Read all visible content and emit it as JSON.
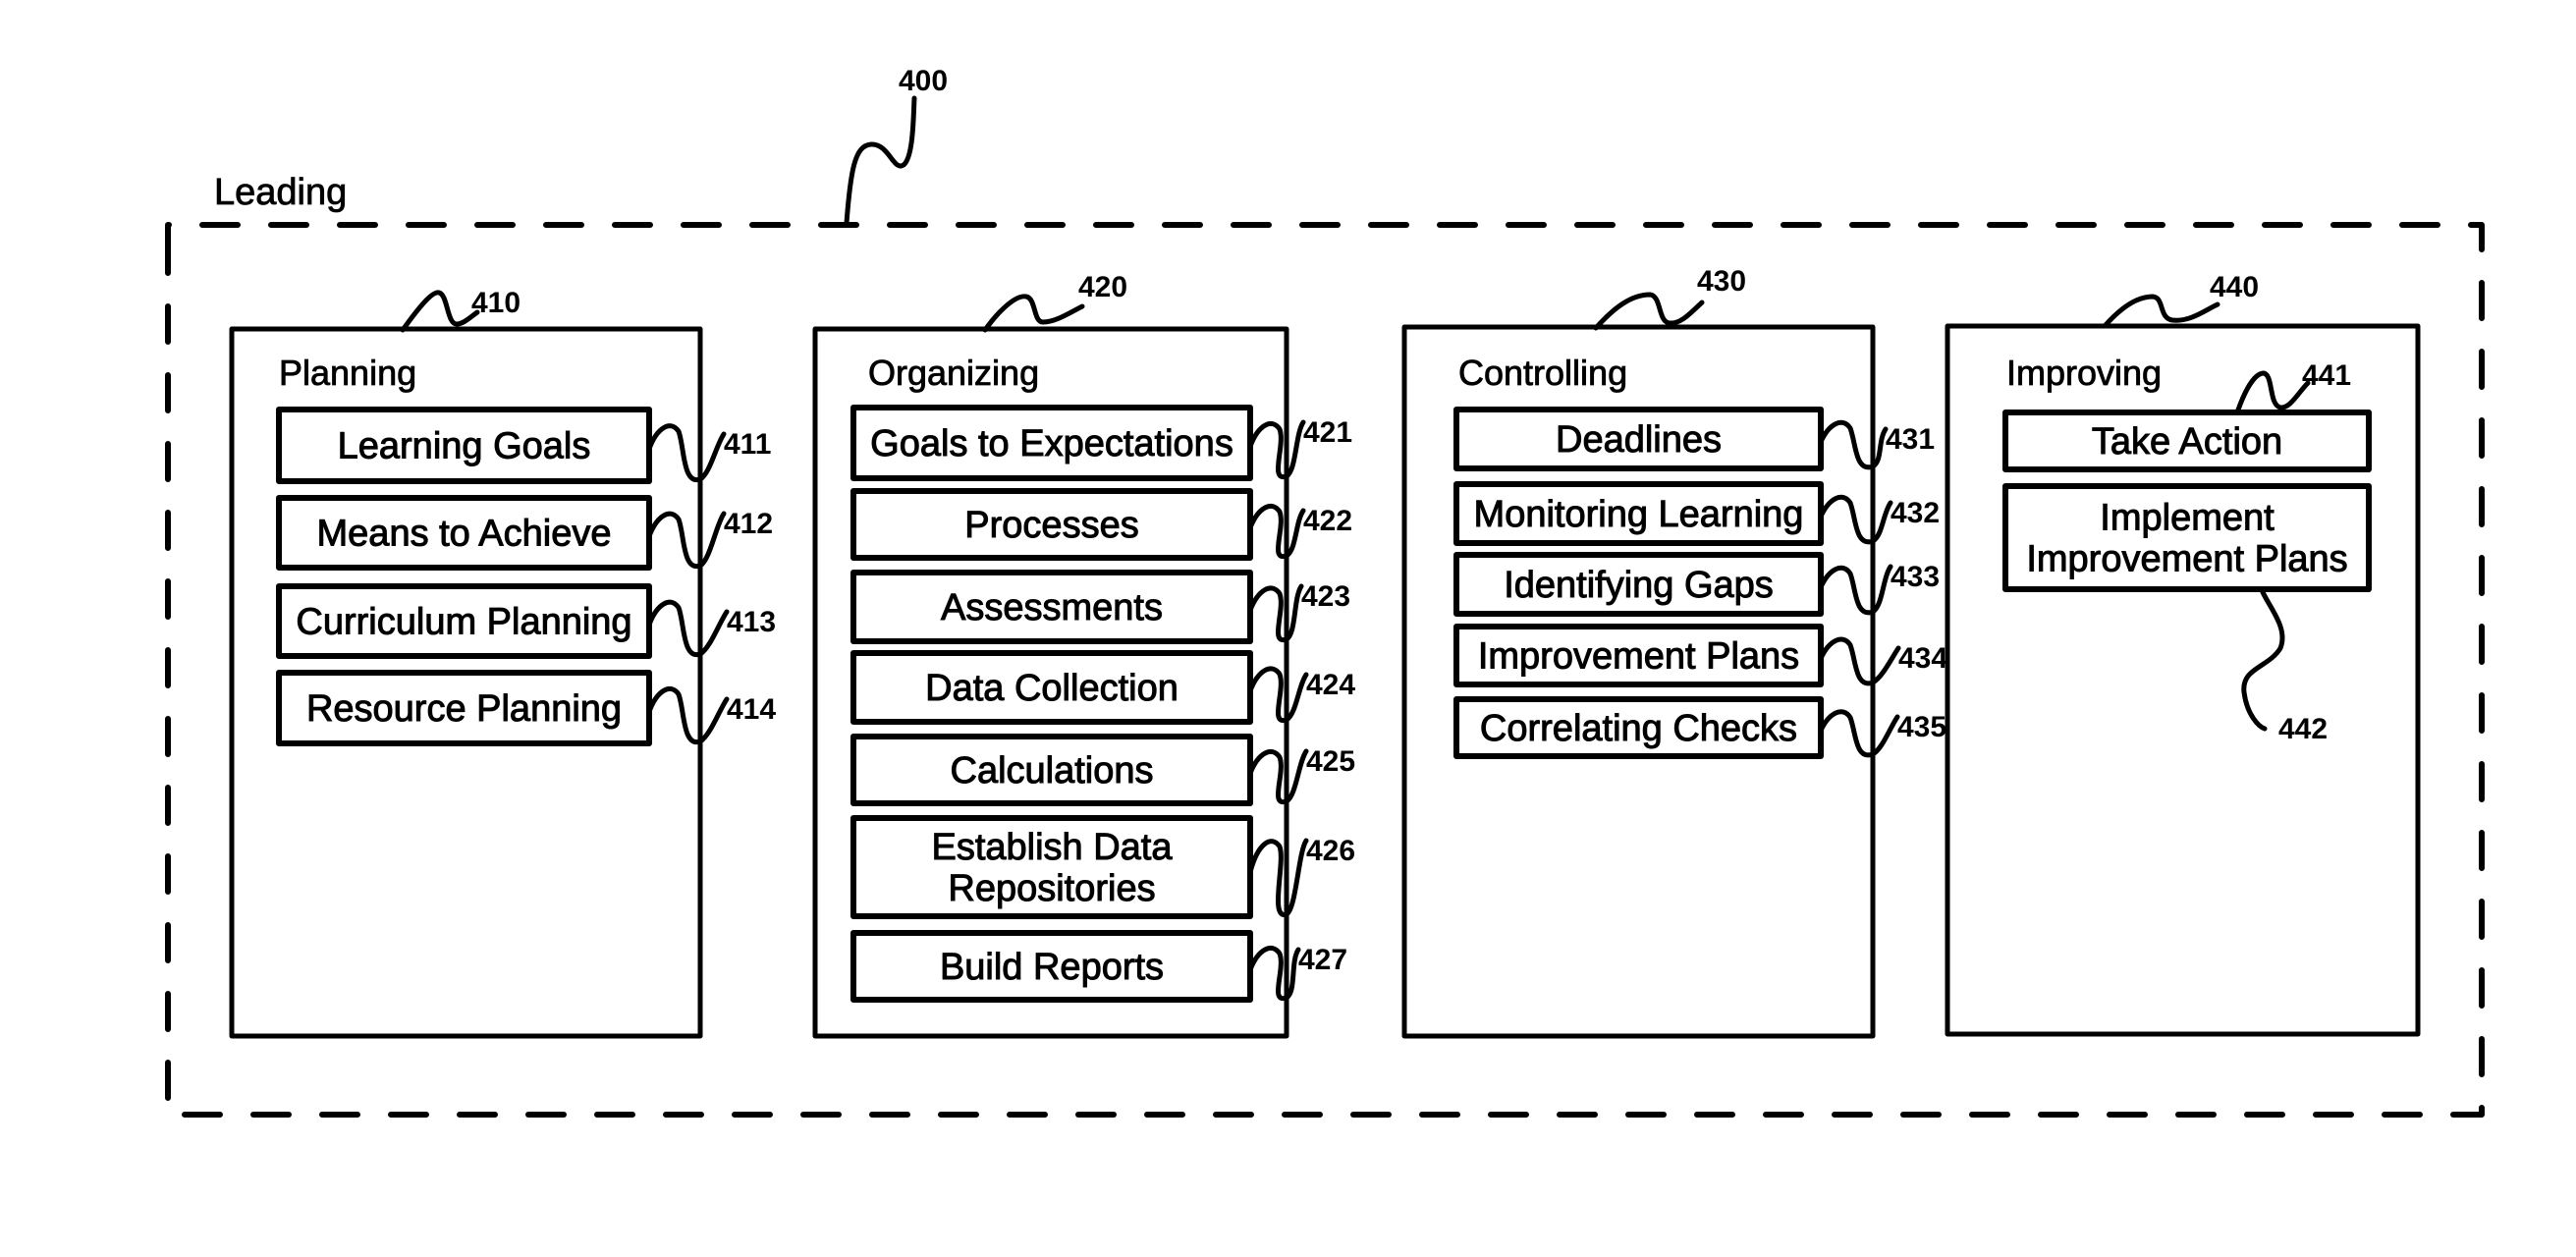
{
  "figure": {
    "reference": "400",
    "container_label": "Leading"
  },
  "columns": [
    {
      "reference": "410",
      "title": "Planning",
      "items": [
        {
          "label": "Learning Goals",
          "reference": "411"
        },
        {
          "label": "Means to Achieve",
          "reference": "412"
        },
        {
          "label": "Curriculum Planning",
          "reference": "413"
        },
        {
          "label": "Resource Planning",
          "reference": "414"
        }
      ]
    },
    {
      "reference": "420",
      "title": "Organizing",
      "items": [
        {
          "label": "Goals to Expectations",
          "reference": "421"
        },
        {
          "label": "Processes",
          "reference": "422"
        },
        {
          "label": "Assessments",
          "reference": "423"
        },
        {
          "label": "Data Collection",
          "reference": "424"
        },
        {
          "label": "Calculations",
          "reference": "425"
        },
        {
          "label": "Establish Data Repositories",
          "lines": [
            "Establish Data",
            "Repositories"
          ],
          "reference": "426"
        },
        {
          "label": "Build Reports",
          "reference": "427"
        }
      ]
    },
    {
      "reference": "430",
      "title": "Controlling",
      "items": [
        {
          "label": "Deadlines",
          "reference": "431"
        },
        {
          "label": "Monitoring Learning",
          "reference": "432"
        },
        {
          "label": "Identifying Gaps",
          "reference": "433"
        },
        {
          "label": "Improvement Plans",
          "reference": "434"
        },
        {
          "label": "Correlating Checks",
          "reference": "435"
        }
      ]
    },
    {
      "reference": "440",
      "title": "Improving",
      "items": [
        {
          "label": "Take Action",
          "reference": "441"
        },
        {
          "label": "Implement Improvement Plans",
          "lines": [
            "Implement",
            "Improvement Plans"
          ],
          "reference": "442"
        }
      ]
    }
  ]
}
